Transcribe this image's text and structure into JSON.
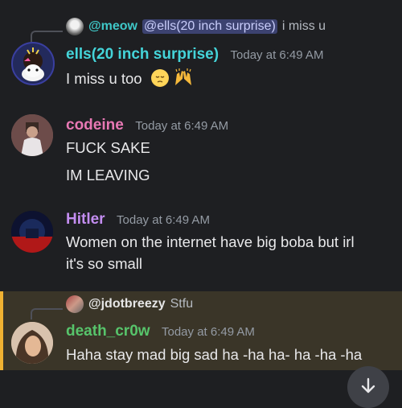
{
  "colors": {
    "background": "#1e1f22",
    "highlight": "#3a3528",
    "highlight_border": "#f0b232",
    "mention_bg": "#3c4270"
  },
  "messages": [
    {
      "reply": {
        "username": "@meow",
        "username_color": "#3fc8c8",
        "mention": "@ells(20 inch surprise)",
        "text": "i miss u"
      },
      "username": "ells(20 inch surprise)",
      "username_color": "#44d4d9",
      "timestamp": "Today at 6:49 AM",
      "lines": [
        "I miss u too"
      ],
      "emojis": [
        "pensive-face-emoji",
        "raising-hands-emoji"
      ]
    },
    {
      "username": "codeine",
      "username_color": "#e878b4",
      "timestamp": "Today at 6:49 AM",
      "lines": [
        "FUCK SAKE",
        "IM LEAVING"
      ]
    },
    {
      "username": "Hitler",
      "username_color": "#c38df0",
      "timestamp": "Today at 6:49 AM",
      "lines": [
        "Women on the internet have big boba but irl",
        "it's so small"
      ]
    },
    {
      "reply": {
        "username": "@jdotbreezy",
        "username_color": "#e6e6e6",
        "text": "Stfu"
      },
      "username": "death_cr0w",
      "username_color": "#57c46b",
      "timestamp": "Today at 6:49 AM",
      "lines": [
        "Haha stay mad big sad ha -ha ha- ha -ha -ha"
      ],
      "highlighted": true
    }
  ],
  "scroll_button": {
    "icon": "arrow-down-icon"
  }
}
